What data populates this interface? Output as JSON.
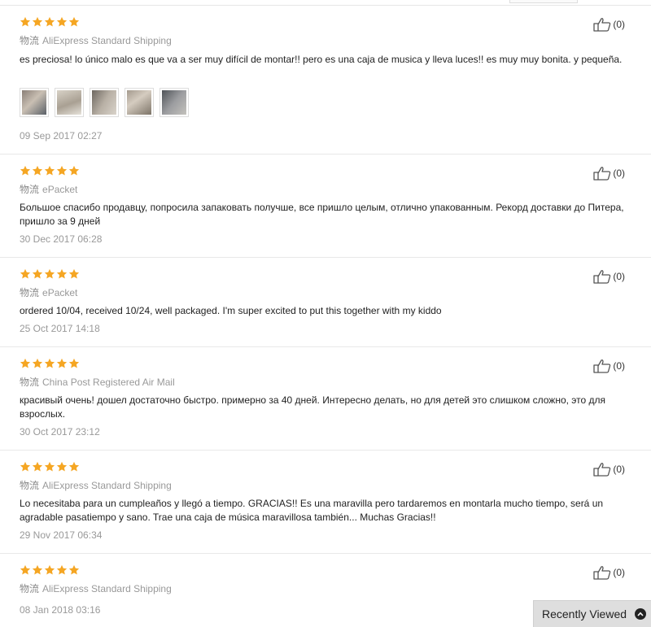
{
  "reviews": [
    {
      "shipping_prefix": "物流",
      "shipping": "AliExpress Standard Shipping",
      "text": "es preciosa! lo único malo es que va a ser muy difícil de montar!! pero es una caja de musica y lleva luces!! es muy muy bonita. y pequeña.",
      "date": "09 Sep 2017 02:27",
      "helpful_count": "(0)",
      "rating": 5,
      "photos": 5
    },
    {
      "shipping_prefix": "物流",
      "shipping": "ePacket",
      "text": "Большое спасибо продавцу, попросила запаковать получше, все пришло целым, отлично упакованным. Рекорд доставки до Питера, пришло за 9 дней",
      "date": "30 Dec 2017 06:28",
      "helpful_count": "(0)",
      "rating": 5
    },
    {
      "shipping_prefix": "物流",
      "shipping": "ePacket",
      "text": "ordered 10/04, received 10/24, well packaged. I'm super excited to put this together with my kiddo",
      "date": "25 Oct 2017 14:18",
      "helpful_count": "(0)",
      "rating": 5
    },
    {
      "shipping_prefix": "物流",
      "shipping": "China Post Registered Air Mail",
      "text": "красивый очень! дошел достаточно быстро. примерно за 40 дней. Интересно делать, но для детей это слишком сложно, это для взрослых.",
      "date": "30 Oct 2017 23:12",
      "helpful_count": "(0)",
      "rating": 5
    },
    {
      "shipping_prefix": "物流",
      "shipping": "AliExpress Standard Shipping",
      "text": "Lo necesitaba para un cumpleaños y llegó a tiempo. GRACIAS!! Es una maravilla pero tardaremos en montarla mucho tiempo, será un agradable pasatiempo y sano. Trae una caja de música maravillosa también... Muchas Gracias!!",
      "date": "29 Nov 2017 06:34",
      "helpful_count": "(0)",
      "rating": 5
    },
    {
      "shipping_prefix": "物流",
      "shipping": "AliExpress Standard Shipping",
      "text": "",
      "date": "08 Jan 2018 03:16",
      "helpful_count": "(0)",
      "rating": 5
    }
  ],
  "recently_viewed": {
    "label": "Recently Viewed",
    "icon": "chevron-up-icon"
  },
  "colors": {
    "star": "#f5a623",
    "divider": "#e8e8e8",
    "muted": "#999999"
  }
}
